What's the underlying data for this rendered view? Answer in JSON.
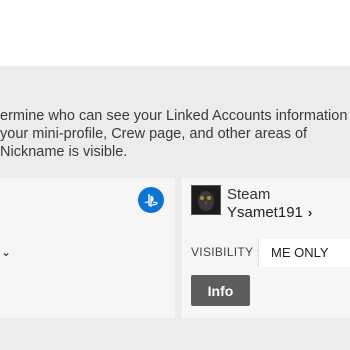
{
  "description": {
    "line1": "ermine who can see your Linked Accounts information or",
    "line2": "your mini-profile, Crew page, and other areas of",
    "line3": " Nickname is visible."
  },
  "left_card": {
    "dropdown_chevron": "⌄",
    "platform_icon": "playstation-icon"
  },
  "right_card": {
    "platform": "Steam",
    "account_name": "Ysamet191",
    "account_chevron": "›",
    "visibility_label": "VISIBILITY :",
    "visibility_value": "ME ONLY",
    "info_button": "Info"
  },
  "colors": {
    "panel_bg": "#ececec",
    "card_bg": "#f6f6f6",
    "playstation_blue": "#0f73d4",
    "button_bg": "#5d5d5d"
  }
}
